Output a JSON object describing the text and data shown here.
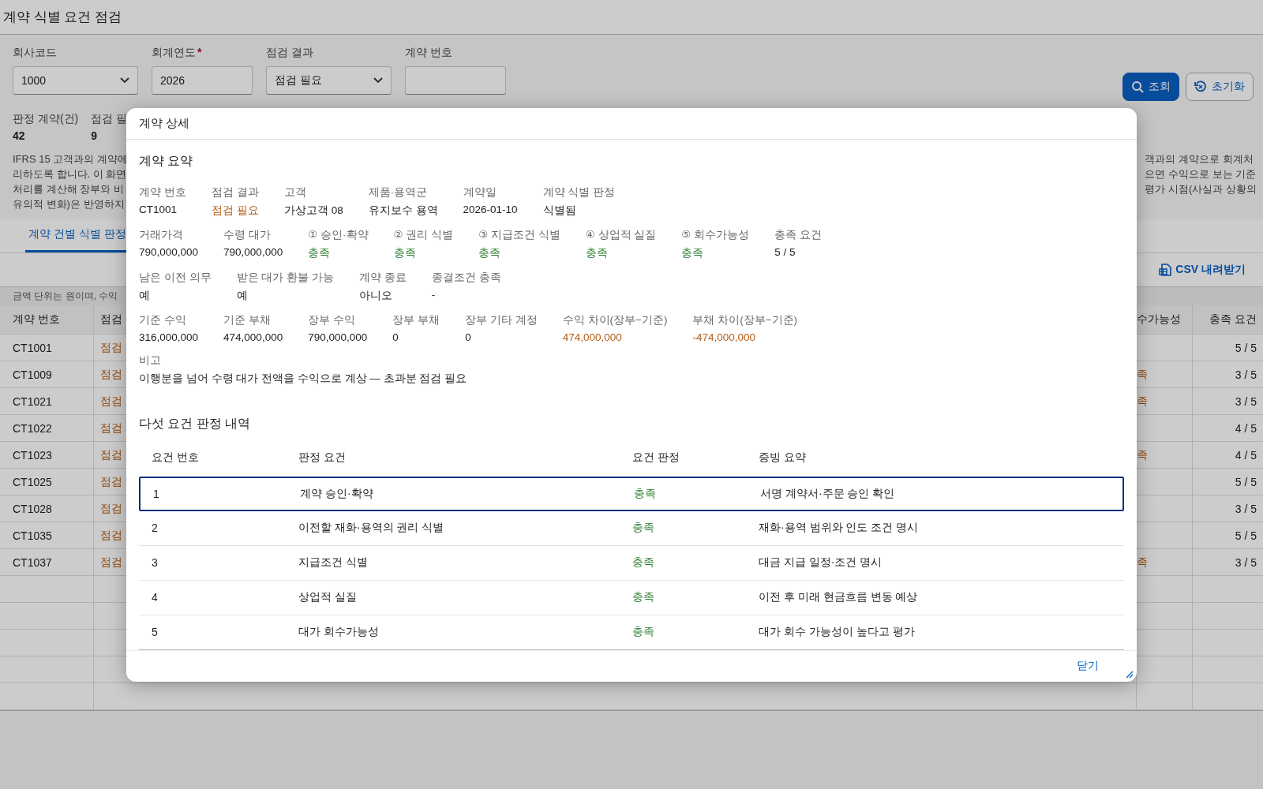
{
  "page": {
    "title": "계약 식별 요건 점검"
  },
  "filters": [
    {
      "kind": "select",
      "label": "회사코드",
      "value": "1000"
    },
    {
      "kind": "input",
      "label": "회계연도",
      "required_mark": "*",
      "value": "2026"
    },
    {
      "kind": "select",
      "label": "점검 결과",
      "value": "점검 필요"
    },
    {
      "kind": "input",
      "label": "계약 번호"
    }
  ],
  "actions": [
    {
      "kind": "primary",
      "label": "조회"
    },
    {
      "kind": "secondary",
      "label": "초기화"
    }
  ],
  "summary": [
    {
      "label": "판정 계약(건)",
      "value": "42"
    },
    {
      "label": "점검 필",
      "value": "9"
    }
  ],
  "description": {
    "left_lines": [
      "IFRS 15 고객과의 계약에",
      "리하도록 합니다. 이 화면",
      "처리를 계산해 장부와 비",
      "유의적 변화)은 반영하지"
    ],
    "right_lines": [
      "객과의 계약으로 회계처",
      "으면 수익으로 보는 기준",
      "평가 시점(사실과 상황의"
    ]
  },
  "tabs": [
    {
      "label": "계약 건별 식별 판정",
      "selected": true
    }
  ],
  "toolbar": {
    "export_label": "CSV 내려받기"
  },
  "note": "금액 단위는 원이며, 수익",
  "table": {
    "columns": [
      "계약 번호",
      "점검",
      "수가능성",
      "충족 요건"
    ],
    "rows": [
      [
        "CT1001",
        "점검",
        "",
        "5 / 5"
      ],
      [
        "CT1009",
        "점검",
        "족",
        "3 / 5"
      ],
      [
        "CT1021",
        "점검",
        "족",
        "3 / 5"
      ],
      [
        "CT1022",
        "점검",
        "",
        "4 / 5"
      ],
      [
        "CT1023",
        "점검",
        "족",
        "4 / 5"
      ],
      [
        "CT1025",
        "점검",
        "",
        "5 / 5"
      ],
      [
        "CT1028",
        "점검",
        "",
        "3 / 5"
      ],
      [
        "CT1035",
        "점검",
        "",
        "5 / 5"
      ],
      [
        "CT1037",
        "점검",
        "족",
        "3 / 5"
      ]
    ]
  },
  "dialog": {
    "title": "계약 상세",
    "summary_title": "계약 요약",
    "field_rows": [
      [
        {
          "label": "계약 번호",
          "value": "CT1001"
        },
        {
          "label": "점검 결과",
          "value": "점검 필요",
          "color": "#b35c12"
        },
        {
          "label": "고객",
          "value": "가상고객 08"
        },
        {
          "label": "제품·용역군",
          "value": "유지보수 용역"
        },
        {
          "label": "계약일",
          "value": "2026-01-10"
        },
        {
          "label": "계약 식별 판정",
          "value": "식별됨"
        }
      ],
      [
        {
          "label": "거래가격",
          "value": "790,000,000"
        },
        {
          "label": "수령 대가",
          "value": "790,000,000"
        },
        {
          "label": "① 승인·확약",
          "value": "충족",
          "color": "#2e7d32"
        },
        {
          "label": "② 권리 식별",
          "value": "충족",
          "color": "#2e7d32"
        },
        {
          "label": "③ 지급조건 식별",
          "value": "충족",
          "color": "#2e7d32"
        },
        {
          "label": "④ 상업적 실질",
          "value": "충족",
          "color": "#2e7d32"
        },
        {
          "label": "⑤ 회수가능성",
          "value": "충족",
          "color": "#2e7d32"
        },
        {
          "label": "충족 요건",
          "value": "5 / 5"
        }
      ],
      [
        {
          "label": "남은 이전 의무",
          "value": "예"
        },
        {
          "label": "받은 대가 환불 가능",
          "value": "예"
        },
        {
          "label": "계약 종료",
          "value": "아니오"
        },
        {
          "label": "종결조건 충족",
          "value": "-"
        }
      ],
      [
        {
          "label": "기준 수익",
          "value": "316,000,000"
        },
        {
          "label": "기준 부채",
          "value": "474,000,000"
        },
        {
          "label": "장부 수익",
          "value": "790,000,000"
        },
        {
          "label": "장부 부채",
          "value": "0"
        },
        {
          "label": "장부 기타 계정",
          "value": "0"
        },
        {
          "label": "수익 차이(장부−기준)",
          "value": "474,000,000",
          "color": "#b35c12"
        },
        {
          "label": "부채 차이(장부−기준)",
          "value": "-474,000,000",
          "color": "#b35c12"
        }
      ]
    ],
    "remark_label": "비고",
    "remark": "이행분을 넘어 수령 대가 전액을 수익으로 계상 — 초과분 점검 필요",
    "criteria_title": "다섯 요건 판정 내역",
    "criteria_columns": [
      "요건 번호",
      "판정 요건",
      "요건 판정",
      "증빙 요약"
    ],
    "criteria": [
      {
        "no": "1",
        "name": "계약 승인·확약",
        "result": "충족",
        "evidence": "서명 계약서·주문 승인 확인",
        "selected": true
      },
      {
        "no": "2",
        "name": "이전할 재화·용역의 권리 식별",
        "result": "충족",
        "evidence": "재화·용역 범위와 인도 조건 명시",
        "selected": false
      },
      {
        "no": "3",
        "name": "지급조건 식별",
        "result": "충족",
        "evidence": "대금 지급 일정·조건 명시",
        "selected": false
      },
      {
        "no": "4",
        "name": "상업적 실질",
        "result": "충족",
        "evidence": "이전 후 미래 현금흐름 변동 예상",
        "selected": false
      },
      {
        "no": "5",
        "name": "대가 회수가능성",
        "result": "충족",
        "evidence": "대가 회수 가능성이 높다고 평가",
        "selected": false
      }
    ],
    "close_label": "닫기"
  }
}
